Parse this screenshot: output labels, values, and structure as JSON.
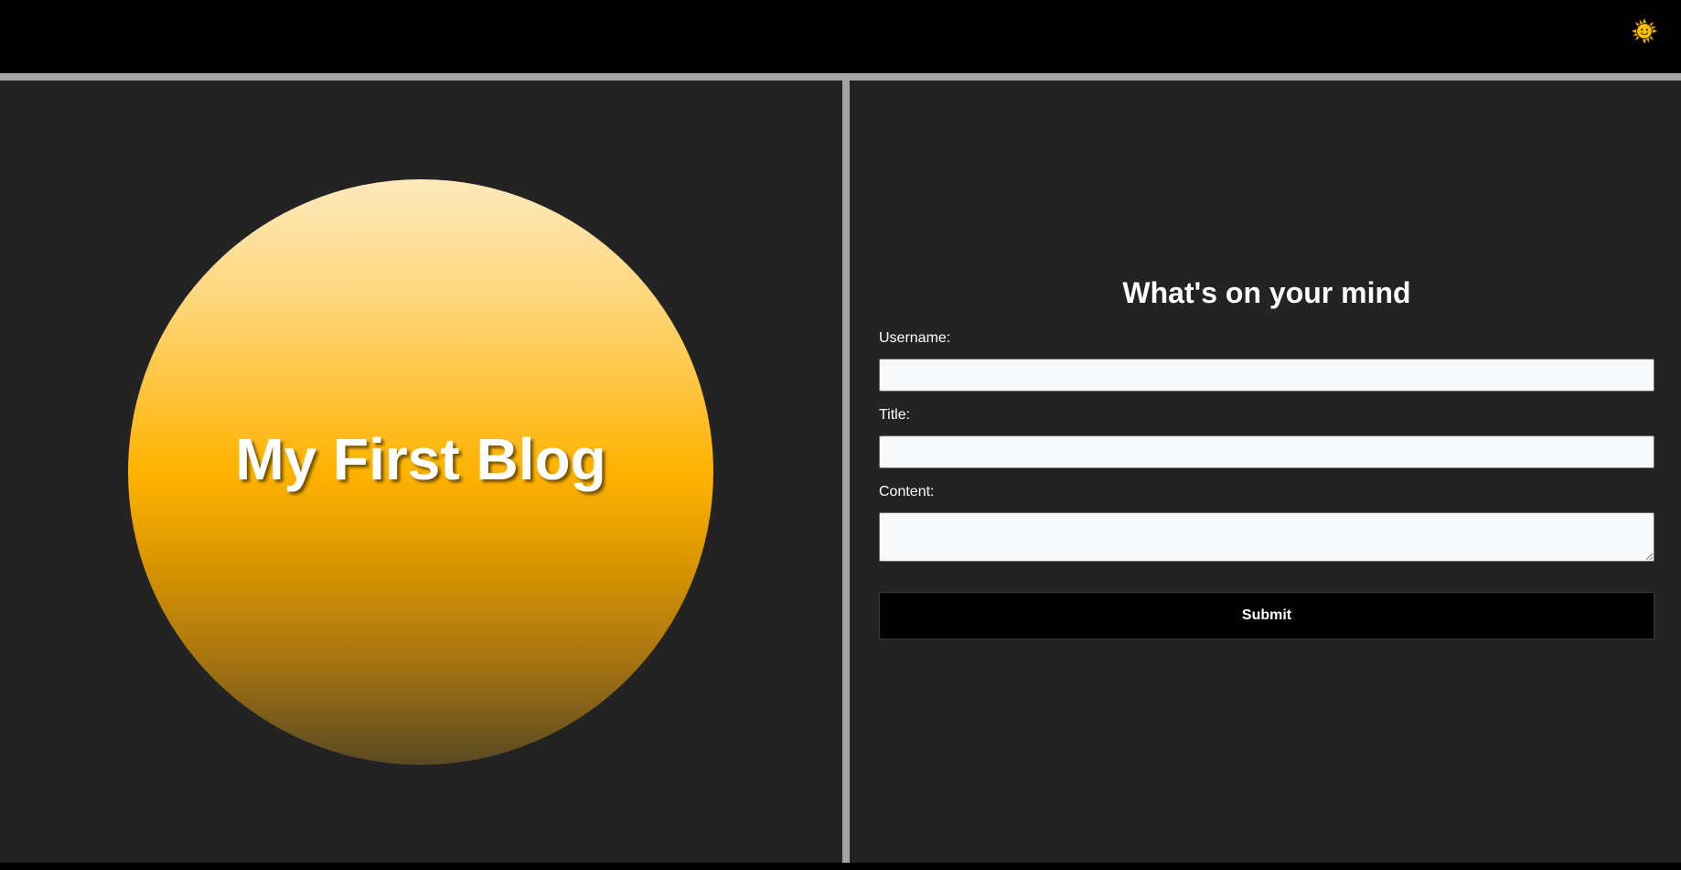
{
  "header": {
    "theme_toggle_icon": "sun-icon",
    "sun_color": "#ffc000"
  },
  "hero": {
    "title": "My First Blog",
    "gradient_colors": [
      "#fde9bd",
      "#ffb300",
      "#5a4a22"
    ]
  },
  "form": {
    "heading": "What's on your mind",
    "username_label": "Username:",
    "username_value": "",
    "title_label": "Title:",
    "title_value": "",
    "content_label": "Content:",
    "content_value": "",
    "submit_label": "Submit"
  },
  "colors": {
    "page_background": "#000000",
    "panel_background": "#232323",
    "divider": "#a3a3a3",
    "input_background": "#f8f9fa",
    "button_background": "#000000"
  }
}
